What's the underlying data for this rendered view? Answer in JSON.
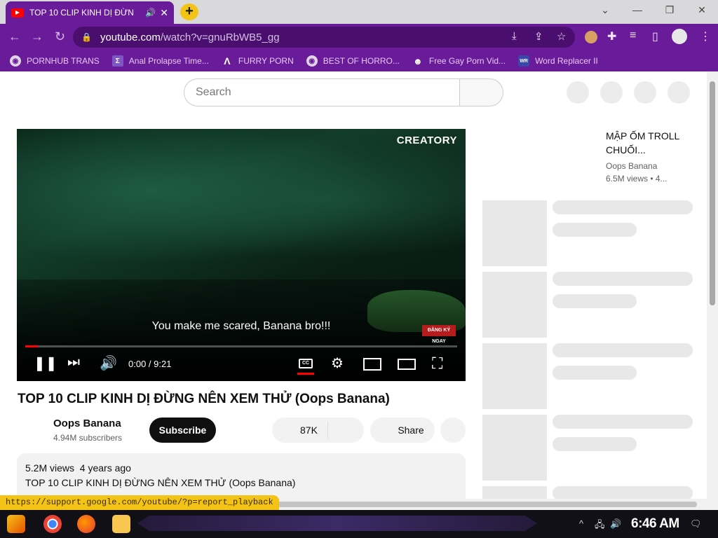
{
  "browser": {
    "tab_title": "TOP 10 CLIP KINH DỊ ĐỪN",
    "url_host": "youtube.com",
    "url_path": "/watch?v=gnuRbWB5_gg",
    "theme_color": "#6a1b9a"
  },
  "bookmarks": [
    {
      "label": "PORNHUB TRANS",
      "icon": "globe-icon"
    },
    {
      "label": "Anal Prolapse Time...",
      "icon": "bookmark-icon"
    },
    {
      "label": "FURRY PORN",
      "icon": "site-icon"
    },
    {
      "label": "BEST OF HORRO...",
      "icon": "globe-icon"
    },
    {
      "label": "Free Gay Porn Vid...",
      "icon": "site-icon"
    },
    {
      "label": "Word Replacer II",
      "icon": "extension-icon"
    }
  ],
  "youtube": {
    "search_placeholder": "Search",
    "video": {
      "brand": "CREATORY",
      "subtitle": "You make me scared, Banana bro!!!",
      "badge": "ĐĂNG KÝ NGAY",
      "timecode": "0:00 / 9:21",
      "progress": 0.03
    },
    "title": "TOP 10 CLIP KINH DỊ ĐỪNG NÊN XEM THỬ (Oops Banana)",
    "channel": "Oops Banana",
    "subscribers": "4.94M subscribers",
    "subscribe_label": "Subscribe",
    "likes": "87K",
    "share_label": "Share",
    "views_line": "5.2M views  4 years ago",
    "description": "TOP 10 CLIP KINH DỊ ĐỪNG NÊN XEM THỬ (Oops Banana)",
    "sidebar": {
      "title": "MẬP ỐM TROLL CHUỐI...",
      "channel": "Oops Banana",
      "views": "6.5M views  • 4..."
    }
  },
  "status_url": "https://support.google.com/youtube/?p=report_playback",
  "taskbar": {
    "clock": "6:46 AM"
  }
}
